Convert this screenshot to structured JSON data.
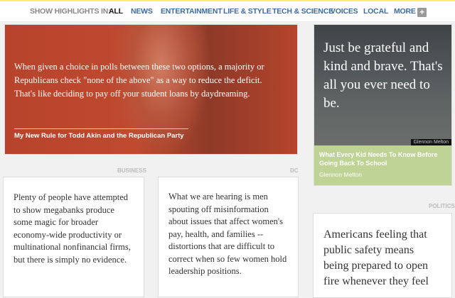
{
  "nav": {
    "label": "SHOW HIGHLIGHTS IN:",
    "items": [
      "ALL",
      "NEWS",
      "ENTERTAINMENT",
      "LIFE & STYLE",
      "TECH & SCIENCE",
      "VOICES",
      "LOCAL",
      "MORE"
    ],
    "plus": "+"
  },
  "hero": {
    "quote": "When given a choice in polls between these two options, a majority or Republicans check \"none of the above\" as a way to reduce the deficit. That's like deciding to pay off your student loans by daydreaming.",
    "title": "My New Rule for Todd Akin and the Republican Party"
  },
  "side": {
    "quote": "Just be grateful and kind and brave. That's all you ever need to be.",
    "credit": "Glennon Melton",
    "title": "What Every Kid Needs To Know Before Going Back To School",
    "author": "Glennon Melton"
  },
  "cards": [
    {
      "section": "BUSINESS",
      "text": "Plenty of people have attempted to show megabanks produce some magic for broader economy-wide productivity or multinational nonfinancial firms, but there is simply no evidence."
    },
    {
      "section": "DC",
      "text": "What we are hearing is men spouting off misinformation about issues that affect women's pay, health, and families -- distortions that are difficult to correct when so few women hold leadership positions."
    },
    {
      "section": "POLITICS",
      "text": "Americans feeling that public safety means being prepared to open fire whenever they feel"
    }
  ]
}
